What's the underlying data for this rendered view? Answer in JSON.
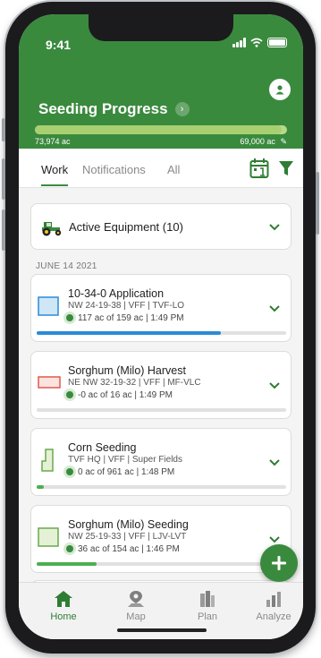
{
  "status_bar": {
    "time": "9:41"
  },
  "header": {
    "title": "Seeding Progress",
    "progress_fraction": 0.98,
    "progress_left_label": "73,974 ac",
    "progress_right_label": "69,000 ac"
  },
  "tabs": [
    {
      "label": "Work",
      "active": true
    },
    {
      "label": "Notifications",
      "active": false
    },
    {
      "label": "All",
      "active": false
    }
  ],
  "equipment": {
    "label": "Active Equipment (10)"
  },
  "date_header": "JUNE 14 2021",
  "jobs": [
    {
      "title": "10-34-0 Application",
      "subtitle": "NW 24-19-38 | VFF | TVF-LO",
      "stat": "117 ac of 159 ac | 1:49 PM",
      "progress": 0.74,
      "color": "#2b8ad6"
    },
    {
      "title": "Sorghum (Milo) Harvest",
      "subtitle": "NE NW 32-19-32 | VFF | MF-VLC",
      "stat": "-0 ac of 16 ac | 1:49 PM",
      "progress": 0.0,
      "color": "#2b8ad6"
    },
    {
      "title": "Corn Seeding",
      "subtitle": "TVF HQ | VFF | Super Fields",
      "stat": "0 ac of 961 ac | 1:48 PM",
      "progress": 0.03,
      "color": "#4caf50"
    },
    {
      "title": "Sorghum (Milo) Seeding",
      "subtitle": "NW 25-19-33 | VFF | LJV-LVT",
      "stat": "36 ac of 154 ac | 1:46 PM",
      "progress": 0.24,
      "color": "#4caf50"
    }
  ],
  "nav": [
    {
      "label": "Home",
      "active": true
    },
    {
      "label": "Map",
      "active": false
    },
    {
      "label": "Plan",
      "active": false
    },
    {
      "label": "Analyze",
      "active": false
    }
  ],
  "colors": {
    "brand_green": "#3a8a3e",
    "progress_blue": "#2b8ad6"
  },
  "icons": [
    "profile-icon",
    "calendar-icon",
    "filter-icon",
    "tractor-icon",
    "chevron-down-icon",
    "plus-icon",
    "home-icon",
    "map-pin-icon",
    "plan-icon",
    "analyze-icon"
  ]
}
